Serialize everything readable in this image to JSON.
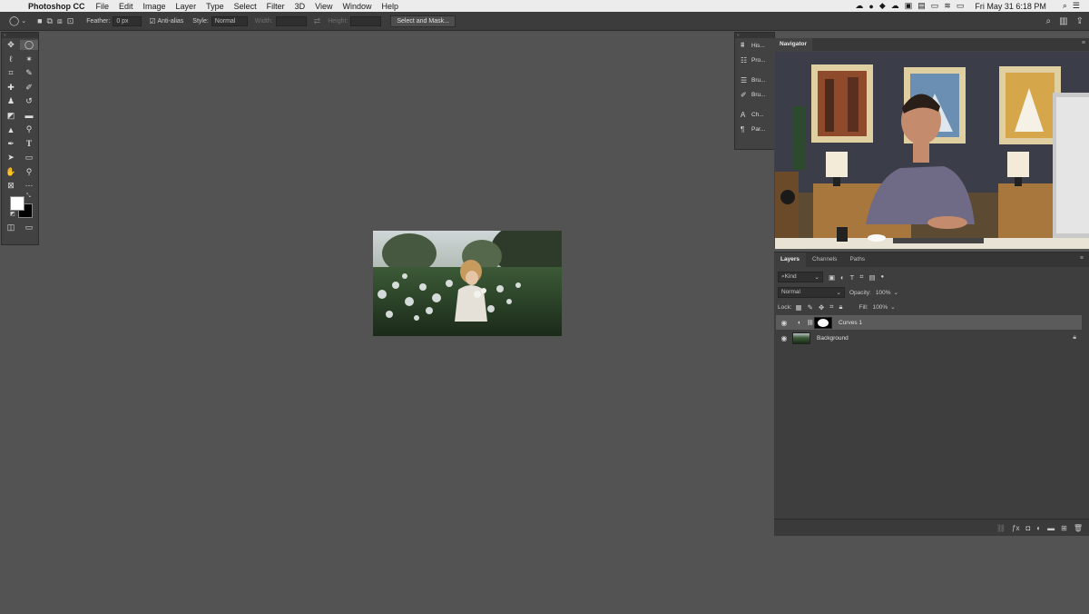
{
  "menubar": {
    "app_name": "Photoshop CC",
    "items": [
      "File",
      "Edit",
      "Image",
      "Layer",
      "Type",
      "Select",
      "Filter",
      "3D",
      "View",
      "Window",
      "Help"
    ],
    "clock": "Fri May 31  6:18 PM"
  },
  "options_bar": {
    "feather_label": "Feather:",
    "feather_value": "0 px",
    "antialias_label": "Anti-alias",
    "style_label": "Style:",
    "style_value": "Normal",
    "width_label": "Width:",
    "height_label": "Height:",
    "select_mask_button": "Select and Mask..."
  },
  "icon_strip": {
    "items": [
      "His...",
      "Pro...",
      "Bru...",
      "Bru...",
      "Ch...",
      "Par..."
    ]
  },
  "navigator": {
    "tab": "Navigator"
  },
  "layers_panel": {
    "tabs": [
      "Layers",
      "Channels",
      "Paths"
    ],
    "filter_value": "Kind",
    "blend_mode": "Normal",
    "opacity_label": "Opacity:",
    "opacity_value": "100%",
    "lock_label": "Lock:",
    "fill_label": "Fill:",
    "fill_value": "100%",
    "layers": [
      {
        "name": "Curves 1",
        "selected": true
      },
      {
        "name": "Background",
        "selected": false
      }
    ]
  },
  "colors": {
    "foreground": "#ffffff",
    "background": "#000000",
    "workspace": "#535353"
  }
}
